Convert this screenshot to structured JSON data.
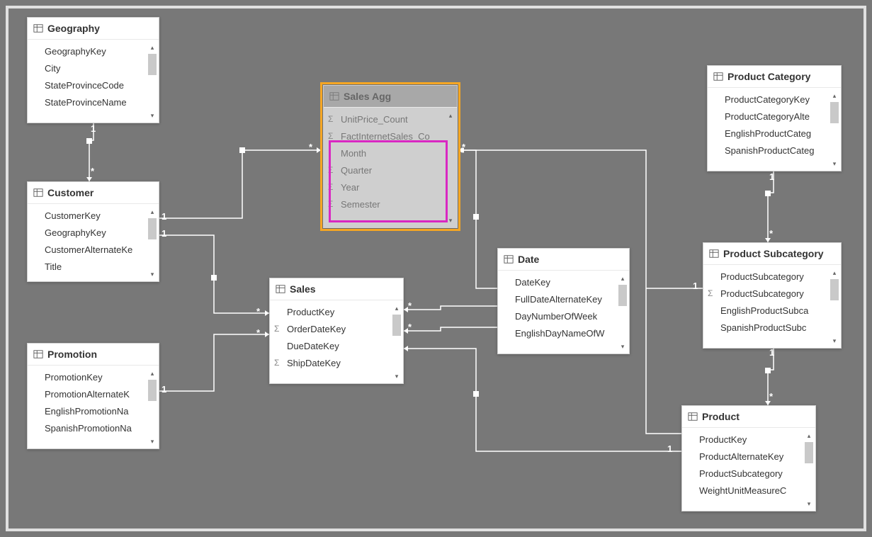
{
  "tables": {
    "geography": {
      "title": "Geography",
      "fields": [
        "GeographyKey",
        "City",
        "StateProvinceCode",
        "StateProvinceName"
      ]
    },
    "customer": {
      "title": "Customer",
      "fields": [
        "CustomerKey",
        "GeographyKey",
        "CustomerAlternateKe",
        "Title"
      ]
    },
    "promotion": {
      "title": "Promotion",
      "fields": [
        "PromotionKey",
        "PromotionAlternateK",
        "EnglishPromotionNa",
        "SpanishPromotionNa"
      ]
    },
    "salesagg": {
      "title": "Sales Agg",
      "fields": [
        {
          "name": "UnitPrice_Count",
          "sigma": true
        },
        {
          "name": "FactInternetSales_Co",
          "sigma": true
        },
        {
          "name": "Month",
          "sigma": false
        },
        {
          "name": "Quarter",
          "sigma": true
        },
        {
          "name": "Year",
          "sigma": true
        },
        {
          "name": "Semester",
          "sigma": true
        }
      ]
    },
    "sales": {
      "title": "Sales",
      "fields": [
        {
          "name": "ProductKey",
          "sigma": false
        },
        {
          "name": "OrderDateKey",
          "sigma": true
        },
        {
          "name": "DueDateKey",
          "sigma": false
        },
        {
          "name": "ShipDateKey",
          "sigma": true
        }
      ]
    },
    "date": {
      "title": "Date",
      "fields": [
        "DateKey",
        "FullDateAlternateKey",
        "DayNumberOfWeek",
        "EnglishDayNameOfW"
      ]
    },
    "productcategory": {
      "title": "Product Category",
      "fields": [
        "ProductCategoryKey",
        "ProductCategoryAlte",
        "EnglishProductCateg",
        "SpanishProductCateg"
      ]
    },
    "productsubcategory": {
      "title": "Product Subcategory",
      "fields": [
        {
          "name": "ProductSubcategory",
          "sigma": false
        },
        {
          "name": "ProductSubcategory",
          "sigma": true
        },
        {
          "name": "EnglishProductSubca",
          "sigma": false
        },
        {
          "name": "SpanishProductSubc",
          "sigma": false
        }
      ]
    },
    "product": {
      "title": "Product",
      "fields": [
        "ProductKey",
        "ProductAlternateKey",
        "ProductSubcategory",
        "WeightUnitMeasureC"
      ]
    }
  },
  "cardinality": {
    "one": "1",
    "many": "*"
  },
  "relationships": [
    {
      "from": "geography",
      "to": "customer",
      "from_card": "1",
      "to_card": "*"
    },
    {
      "from": "customer",
      "to": "salesagg",
      "from_card": "1",
      "to_card": "*"
    },
    {
      "from": "customer",
      "to": "sales",
      "from_card": "1",
      "to_card": "*"
    },
    {
      "from": "promotion",
      "to": "sales",
      "from_card": "1",
      "to_card": "*"
    },
    {
      "from": "date",
      "to": "salesagg",
      "from_card": "1",
      "to_card": "*"
    },
    {
      "from": "date",
      "to": "sales",
      "from_card": "1",
      "to_card": "*"
    },
    {
      "from": "date",
      "to": "sales",
      "from_card": "1",
      "to_card": "*"
    },
    {
      "from": "productcategory",
      "to": "productsubcategory",
      "from_card": "1",
      "to_card": "*"
    },
    {
      "from": "productsubcategory",
      "to": "product",
      "from_card": "1",
      "to_card": "*"
    },
    {
      "from": "product",
      "to": "salesagg",
      "from_card": "1",
      "to_card": "*"
    },
    {
      "from": "product",
      "to": "sales",
      "from_card": "1",
      "to_card": "*"
    }
  ]
}
